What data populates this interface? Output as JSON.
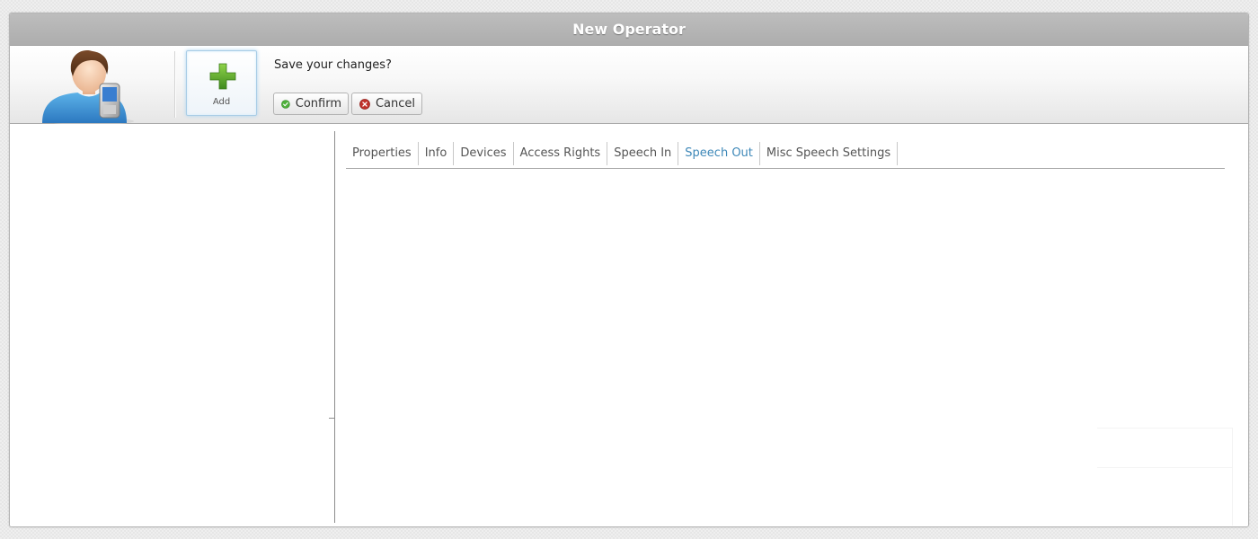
{
  "window": {
    "title": "New Operator"
  },
  "toolbar": {
    "avatar_icon": "operator-with-phone-icon",
    "add_label": "Add",
    "add_icon": "plus-icon",
    "prompt": "Save your changes?",
    "confirm_label": "Confirm",
    "confirm_icon": "check-circle-icon",
    "cancel_label": "Cancel",
    "cancel_icon": "x-circle-icon"
  },
  "tabs": [
    {
      "label": "Properties"
    },
    {
      "label": "Info"
    },
    {
      "label": "Devices"
    },
    {
      "label": "Access Rights"
    },
    {
      "label": "Speech In"
    },
    {
      "label": "Speech Out",
      "active": true
    },
    {
      "label": "Misc Speech Settings"
    }
  ],
  "colors": {
    "title_bar": "#b3b3b3",
    "active_tab": "#3e88b8",
    "add_icon": "#5fa030",
    "confirm_icon": "#4eb03a",
    "cancel_icon": "#c0302a"
  }
}
